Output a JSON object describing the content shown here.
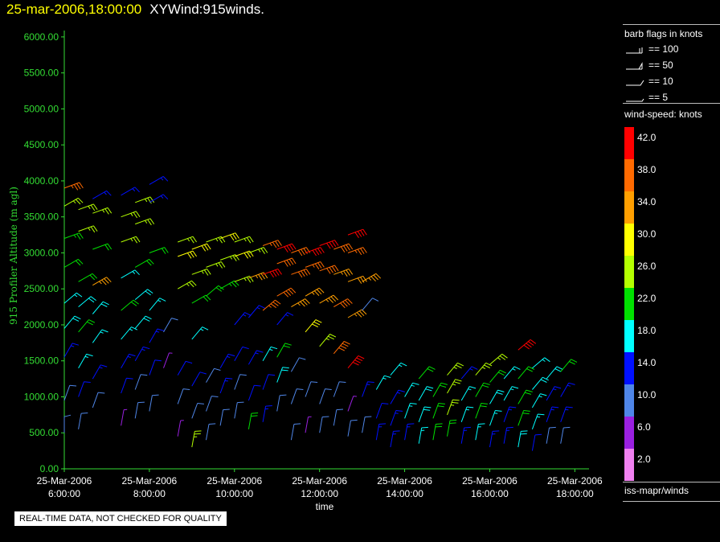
{
  "header": {
    "datetime": "25-mar-2006,18:00:00",
    "dataset": "XYWind:915winds."
  },
  "colors": {
    "axis": "#33dd33",
    "background": "#000000"
  },
  "legend": {
    "barb_title": "barb flags in knots",
    "barb_items": [
      {
        "kind": "100",
        "label": "== 100"
      },
      {
        "kind": "50",
        "label": "== 50"
      },
      {
        "kind": "10",
        "label": "== 10"
      },
      {
        "kind": "5",
        "label": "== 5"
      }
    ],
    "colorbar_title": "wind-speed: knots",
    "colorbar": [
      {
        "label": "42.0",
        "color": "#ff0000"
      },
      {
        "label": "38.0",
        "color": "#ff6a00"
      },
      {
        "label": "34.0",
        "color": "#ff9f00"
      },
      {
        "label": "30.0",
        "color": "#ffff00"
      },
      {
        "label": "26.0",
        "color": "#b4ff00"
      },
      {
        "label": "22.0",
        "color": "#00e000"
      },
      {
        "label": "18.0",
        "color": "#00ffff"
      },
      {
        "label": "14.0",
        "color": "#0010ff"
      },
      {
        "label": "10.0",
        "color": "#4f86e8"
      },
      {
        "label": "6.0",
        "color": "#9a20e0"
      },
      {
        "label": "2.0",
        "color": "#f080f0"
      }
    ],
    "source": "iss-mapr/winds"
  },
  "footnote": "REAL-TIME DATA, NOT CHECKED FOR QUALITY",
  "chart_data": {
    "type": "scatter",
    "ylabel": "915 Profiler Altitude  (m agl)",
    "xlabel": "time",
    "ylim": [
      0,
      6200
    ],
    "y_ticks": [
      "0.00",
      "500.00",
      "1000.00",
      "1500.00",
      "2000.00",
      "2500.00",
      "3000.00",
      "3500.00",
      "4000.00",
      "4500.00",
      "5000.00",
      "5500.00",
      "6000.00"
    ],
    "xlim": [
      "2006-03-25 06:00",
      "2006-03-25 18:20"
    ],
    "x_ticks": [
      {
        "date": "25-Mar-2006",
        "time": "6:00:00"
      },
      {
        "date": "25-Mar-2006",
        "time": "8:00:00"
      },
      {
        "date": "25-Mar-2006",
        "time": "10:00:00"
      },
      {
        "date": "25-Mar-2006",
        "time": "12:00:00"
      },
      {
        "date": "25-Mar-2006",
        "time": "14:00:00"
      },
      {
        "date": "25-Mar-2006",
        "time": "16:00:00"
      },
      {
        "date": "25-Mar-2006",
        "time": "18:00:00"
      }
    ],
    "profiles": [
      {
        "time": "06:00",
        "winds": [
          [
            500,
            8,
            0
          ],
          [
            950,
            11,
            20
          ],
          [
            1550,
            15,
            30
          ],
          [
            1950,
            18,
            40
          ],
          [
            2300,
            17,
            50
          ],
          [
            2800,
            20,
            60
          ],
          [
            3200,
            23,
            70
          ],
          [
            3650,
            25,
            60
          ],
          [
            3900,
            37,
            70
          ]
        ]
      },
      {
        "time": "06:20",
        "winds": [
          [
            550,
            10,
            10
          ],
          [
            1000,
            12,
            20
          ],
          [
            1400,
            16,
            30
          ],
          [
            1900,
            20,
            40
          ],
          [
            2250,
            18,
            50
          ],
          [
            2600,
            20,
            60
          ],
          [
            3300,
            24,
            70
          ],
          [
            3600,
            27,
            70
          ]
        ]
      },
      {
        "time": "06:40",
        "winds": [
          [
            850,
            10,
            20
          ],
          [
            1250,
            13,
            30
          ],
          [
            1750,
            16,
            35
          ],
          [
            2150,
            18,
            40
          ],
          [
            2550,
            33,
            60
          ],
          [
            3050,
            21,
            70
          ],
          [
            3550,
            26,
            70
          ],
          [
            3750,
            15,
            60
          ]
        ]
      },
      {
        "time": "07:20",
        "winds": [
          [
            600,
            7,
            10
          ],
          [
            1050,
            12,
            20
          ],
          [
            1400,
            14,
            30
          ],
          [
            1800,
            17,
            40
          ],
          [
            2200,
            20,
            50
          ],
          [
            2650,
            16,
            60
          ],
          [
            3150,
            24,
            70
          ],
          [
            3500,
            27,
            70
          ],
          [
            3800,
            14,
            60
          ]
        ]
      },
      {
        "time": "07:40",
        "winds": [
          [
            700,
            9,
            10
          ],
          [
            1100,
            11,
            20
          ],
          [
            1500,
            15,
            30
          ],
          [
            1950,
            19,
            40
          ],
          [
            2350,
            18,
            50
          ],
          [
            2800,
            21,
            60
          ],
          [
            3400,
            27,
            70
          ],
          [
            3700,
            26,
            70
          ]
        ]
      },
      {
        "time": "08:00",
        "winds": [
          [
            800,
            10,
            10
          ],
          [
            1300,
            12,
            20
          ],
          [
            1750,
            14,
            30
          ],
          [
            2200,
            16,
            40
          ],
          [
            3000,
            22,
            70
          ],
          [
            3700,
            15,
            60
          ],
          [
            3950,
            14,
            60
          ]
        ]
      },
      {
        "time": "08:20",
        "winds": [
          [
            1400,
            6,
            20
          ],
          [
            1900,
            9,
            30
          ]
        ]
      },
      {
        "time": "08:40",
        "winds": [
          [
            450,
            7,
            10
          ],
          [
            900,
            10,
            20
          ],
          [
            1300,
            12,
            30
          ],
          [
            2500,
            26,
            60
          ],
          [
            2950,
            30,
            70
          ],
          [
            3150,
            26,
            70
          ]
        ]
      },
      {
        "time": "09:00",
        "winds": [
          [
            300,
            27,
            10
          ],
          [
            700,
            9,
            20
          ],
          [
            1150,
            12,
            30
          ],
          [
            1800,
            17,
            40
          ],
          [
            2300,
            20,
            60
          ],
          [
            2700,
            26,
            70
          ],
          [
            3050,
            30,
            70
          ]
        ]
      },
      {
        "time": "09:20",
        "winds": [
          [
            400,
            10,
            10
          ],
          [
            800,
            10,
            20
          ],
          [
            1200,
            11,
            30
          ],
          [
            2400,
            22,
            50
          ],
          [
            2800,
            27,
            70
          ],
          [
            3150,
            26,
            70
          ]
        ]
      },
      {
        "time": "09:40",
        "winds": [
          [
            600,
            9,
            10
          ],
          [
            1050,
            14,
            20
          ],
          [
            1400,
            15,
            30
          ],
          [
            2500,
            23,
            60
          ],
          [
            2900,
            27,
            70
          ],
          [
            3200,
            29,
            70
          ]
        ]
      },
      {
        "time": "10:00",
        "winds": [
          [
            700,
            8,
            10
          ],
          [
            1100,
            11,
            20
          ],
          [
            1500,
            12,
            30
          ],
          [
            2000,
            14,
            40
          ],
          [
            2600,
            26,
            70
          ],
          [
            2950,
            29,
            70
          ],
          [
            3150,
            27,
            70
          ]
        ]
      },
      {
        "time": "10:20",
        "winds": [
          [
            550,
            22,
            10
          ],
          [
            950,
            12,
            20
          ],
          [
            1450,
            14,
            30
          ],
          [
            2100,
            15,
            40
          ],
          [
            2650,
            34,
            70
          ],
          [
            3000,
            27,
            70
          ]
        ]
      },
      {
        "time": "10:40",
        "winds": [
          [
            650,
            15,
            10
          ],
          [
            1100,
            12,
            20
          ],
          [
            1500,
            16,
            30
          ],
          [
            2200,
            37,
            50
          ],
          [
            2700,
            40,
            70
          ],
          [
            3100,
            36,
            70
          ]
        ]
      },
      {
        "time": "11:00",
        "winds": [
          [
            800,
            8,
            10
          ],
          [
            1200,
            18,
            20
          ],
          [
            1550,
            20,
            30
          ],
          [
            2000,
            14,
            40
          ],
          [
            2400,
            38,
            60
          ],
          [
            2850,
            38,
            70
          ],
          [
            3050,
            42,
            70
          ]
        ]
      },
      {
        "time": "11:20",
        "winds": [
          [
            400,
            10,
            10
          ],
          [
            900,
            11,
            20
          ],
          [
            1350,
            9,
            30
          ],
          [
            2250,
            34,
            60
          ],
          [
            2700,
            38,
            70
          ],
          [
            3000,
            38,
            70
          ]
        ]
      },
      {
        "time": "11:40",
        "winds": [
          [
            500,
            6,
            10
          ],
          [
            1000,
            8,
            20
          ],
          [
            1900,
            28,
            40
          ],
          [
            2400,
            33,
            60
          ],
          [
            2800,
            37,
            70
          ],
          [
            3000,
            40,
            70
          ]
        ]
      },
      {
        "time": "12:00",
        "winds": [
          [
            500,
            9,
            10
          ],
          [
            900,
            11,
            20
          ],
          [
            1700,
            26,
            40
          ],
          [
            2300,
            34,
            60
          ],
          [
            2750,
            38,
            70
          ],
          [
            3100,
            42,
            70
          ]
        ]
      },
      {
        "time": "12:20",
        "winds": [
          [
            600,
            8,
            10
          ],
          [
            1000,
            10,
            20
          ],
          [
            1600,
            38,
            40
          ],
          [
            2250,
            38,
            60
          ],
          [
            2700,
            35,
            70
          ],
          [
            3050,
            38,
            70
          ]
        ]
      },
      {
        "time": "12:40",
        "winds": [
          [
            450,
            9,
            10
          ],
          [
            800,
            7,
            20
          ],
          [
            1400,
            42,
            40
          ],
          [
            2100,
            35,
            60
          ],
          [
            2600,
            32,
            70
          ],
          [
            3000,
            36,
            70
          ],
          [
            3250,
            42,
            70
          ]
        ]
      },
      {
        "time": "13:00",
        "winds": [
          [
            500,
            8,
            10
          ],
          [
            1000,
            14,
            20
          ],
          [
            2200,
            8,
            40
          ],
          [
            2600,
            34,
            60
          ]
        ]
      },
      {
        "time": "13:20",
        "winds": [
          [
            400,
            14,
            10
          ],
          [
            700,
            12,
            20
          ],
          [
            1100,
            16,
            30
          ]
        ]
      },
      {
        "time": "13:40",
        "winds": [
          [
            300,
            13,
            10
          ],
          [
            600,
            14,
            20
          ],
          [
            900,
            15,
            30
          ],
          [
            1300,
            17,
            40
          ]
        ]
      },
      {
        "time": "14:00",
        "winds": [
          [
            400,
            14,
            10
          ],
          [
            700,
            16,
            20
          ],
          [
            1000,
            17,
            30
          ]
        ]
      },
      {
        "time": "14:20",
        "winds": [
          [
            350,
            16,
            10
          ],
          [
            650,
            18,
            20
          ],
          [
            950,
            19,
            30
          ],
          [
            1250,
            20,
            40
          ]
        ]
      },
      {
        "time": "14:40",
        "winds": [
          [
            400,
            21,
            10
          ],
          [
            700,
            22,
            20
          ],
          [
            1000,
            21,
            30
          ]
        ]
      },
      {
        "time": "15:00",
        "winds": [
          [
            450,
            22,
            10
          ],
          [
            750,
            24,
            20
          ],
          [
            1050,
            24,
            30
          ],
          [
            1300,
            24,
            40
          ]
        ]
      },
      {
        "time": "15:20",
        "winds": [
          [
            350,
            14,
            10
          ],
          [
            650,
            16,
            20
          ],
          [
            950,
            17,
            30
          ],
          [
            1250,
            14,
            40
          ]
        ]
      },
      {
        "time": "15:40",
        "winds": [
          [
            400,
            16,
            10
          ],
          [
            700,
            20,
            20
          ],
          [
            1000,
            22,
            30
          ],
          [
            1300,
            24,
            40
          ]
        ]
      },
      {
        "time": "16:00",
        "winds": [
          [
            300,
            15,
            10
          ],
          [
            600,
            17,
            20
          ],
          [
            900,
            18,
            30
          ],
          [
            1200,
            20,
            40
          ],
          [
            1450,
            27,
            50
          ]
        ]
      },
      {
        "time": "16:20",
        "winds": [
          [
            350,
            14,
            10
          ],
          [
            650,
            15,
            20
          ],
          [
            950,
            16,
            30
          ],
          [
            1250,
            17,
            40
          ]
        ]
      },
      {
        "time": "16:40",
        "winds": [
          [
            300,
            18,
            10
          ],
          [
            600,
            20,
            20
          ],
          [
            900,
            22,
            30
          ],
          [
            1250,
            21,
            40
          ],
          [
            1650,
            40,
            50
          ]
        ]
      },
      {
        "time": "17:00",
        "winds": [
          [
            250,
            12,
            10
          ],
          [
            550,
            16,
            20
          ],
          [
            850,
            17,
            30
          ],
          [
            1100,
            18,
            40
          ],
          [
            1400,
            16,
            50
          ]
        ]
      },
      {
        "time": "17:20",
        "winds": [
          [
            350,
            11,
            10
          ],
          [
            650,
            14,
            20
          ],
          [
            950,
            15,
            30
          ],
          [
            1250,
            18,
            40
          ]
        ]
      },
      {
        "time": "17:40",
        "winds": [
          [
            350,
            10,
            10
          ],
          [
            650,
            13,
            20
          ],
          [
            1000,
            14,
            30
          ],
          [
            1350,
            22,
            40
          ]
        ]
      }
    ]
  }
}
